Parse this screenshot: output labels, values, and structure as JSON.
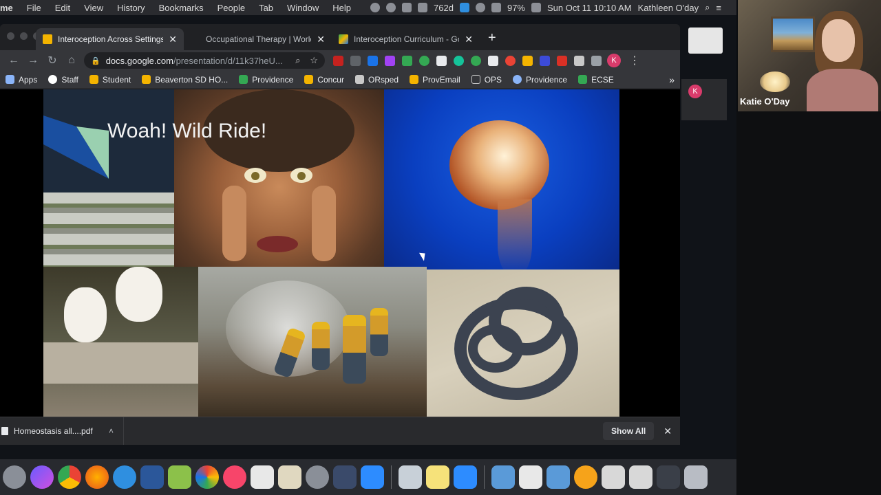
{
  "menubar": {
    "app": "me",
    "items": [
      "File",
      "Edit",
      "View",
      "History",
      "Bookmarks",
      "People",
      "Tab",
      "Window",
      "Help"
    ],
    "temp": "762d",
    "battery": "97%",
    "datetime": "Sun Oct 11  10:10 AM",
    "user": "Kathleen O'day"
  },
  "tabs": [
    {
      "title": "Interoception Across Settings",
      "favicon_color": "#f4b400",
      "active": true
    },
    {
      "title": "Occupational Therapy | World",
      "favicon_color": "#202124",
      "active": false
    },
    {
      "title": "Interoception Curriculum - Go",
      "favicon_color": "#1a73e8",
      "active": false
    }
  ],
  "toolbar": {
    "url_host": "docs.google.com",
    "url_path": "/presentation/d/11k37heU...",
    "profile_initial": "K"
  },
  "bookmarks": [
    {
      "label": "Apps",
      "color": "#8ab4f8"
    },
    {
      "label": "Staff",
      "color": "#ffffff"
    },
    {
      "label": "Student",
      "color": "#f4b400"
    },
    {
      "label": "Beaverton SD HO...",
      "color": "#f4b400"
    },
    {
      "label": "Providence",
      "color": "#34a853"
    },
    {
      "label": "Concur",
      "color": "#f4b400"
    },
    {
      "label": "ORsped",
      "color": "#c8c8c8"
    },
    {
      "label": "ProvEmail",
      "color": "#f4b400"
    },
    {
      "label": "OPS",
      "color": "#c8c8c8"
    },
    {
      "label": "Providence",
      "color": "#8ab4f8"
    },
    {
      "label": "ECSE",
      "color": "#34a853"
    }
  ],
  "slide": {
    "title": "Woah! Wild Ride!"
  },
  "downloads": {
    "file": "Homeostasis all....pdf",
    "show_all": "Show All"
  },
  "webcam": {
    "name": "Katie O'Day"
  },
  "colors": {
    "accent_blue": "#1a4fa0",
    "accent_green": "#9ad0b0",
    "profile_pink": "#d93b6b"
  }
}
